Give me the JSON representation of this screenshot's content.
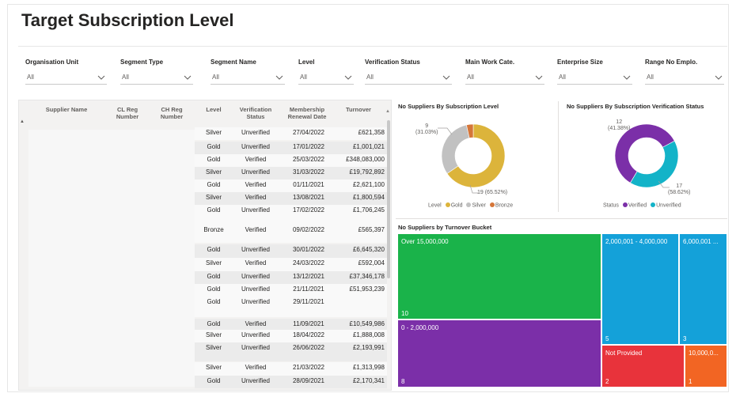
{
  "page": {
    "title": "Target Subscription Level"
  },
  "filters": [
    {
      "label": "Organisation Unit",
      "value": "All"
    },
    {
      "label": "Segment Type",
      "value": "All"
    },
    {
      "label": "Segment Name",
      "value": "All"
    },
    {
      "label": "Level",
      "value": "All"
    },
    {
      "label": "Verification Status",
      "value": "All"
    },
    {
      "label": "Main Work Cate.",
      "value": "All"
    },
    {
      "label": "Enterprise Size",
      "value": "All"
    },
    {
      "label": "Range No Emplo.",
      "value": "All"
    }
  ],
  "table": {
    "columns": [
      "Supplier Name",
      "CL Reg Number",
      "CH Reg Number",
      "Level",
      "Verification Status",
      "Membership Renewal Date",
      "Turnover"
    ],
    "rows": [
      {
        "level": "Silver",
        "status": "Unverified",
        "date": "27/04/2022",
        "turnover": "£621,358"
      },
      {
        "level": "Gold",
        "status": "Unverified",
        "date": "17/01/2022",
        "turnover": "£1,001,021"
      },
      {
        "level": "Gold",
        "status": "Verified",
        "date": "25/03/2022",
        "turnover": "£348,083,000"
      },
      {
        "level": "Silver",
        "status": "Unverified",
        "date": "31/03/2022",
        "turnover": "£19,792,892"
      },
      {
        "level": "Gold",
        "status": "Verified",
        "date": "01/11/2021",
        "turnover": "£2,621,100"
      },
      {
        "level": "Silver",
        "status": "Verified",
        "date": "13/08/2021",
        "turnover": "£1,800,594"
      },
      {
        "level": "Gold",
        "status": "Unverified",
        "date": "17/02/2022",
        "turnover": "£1,706,245"
      },
      {
        "level": "Bronze",
        "status": "Verified",
        "date": "09/02/2022",
        "turnover": "£565,397"
      },
      {
        "level": "Gold",
        "status": "Unverified",
        "date": "30/01/2022",
        "turnover": "£6,645,320"
      },
      {
        "level": "Silver",
        "status": "Verified",
        "date": "24/03/2022",
        "turnover": "£592,004"
      },
      {
        "level": "Gold",
        "status": "Unverified",
        "date": "13/12/2021",
        "turnover": "£37,346,178"
      },
      {
        "level": "Gold",
        "status": "Unverified",
        "date": "21/11/2021",
        "turnover": "£51,953,239"
      },
      {
        "level": "Gold",
        "status": "Unverified",
        "date": "29/11/2021",
        "turnover": ""
      },
      {
        "level": "Gold",
        "status": "Verified",
        "date": "11/09/2021",
        "turnover": "£10,549,986"
      },
      {
        "level": "Silver",
        "status": "Unverified",
        "date": "18/04/2022",
        "turnover": "£1,888,008"
      },
      {
        "level": "Silver",
        "status": "Unverified",
        "date": "26/06/2022",
        "turnover": "£2,193,991"
      },
      {
        "level": "Silver",
        "status": "Verified",
        "date": "21/03/2022",
        "turnover": "£1,313,998"
      },
      {
        "level": "Gold",
        "status": "Unverified",
        "date": "28/09/2021",
        "turnover": "£2,170,341"
      }
    ]
  },
  "chart_data": [
    {
      "type": "pie",
      "title": "No Suppliers By Subscription Level",
      "legend_title": "Level",
      "legend_position": "bottom",
      "categories": [
        "Gold",
        "Silver",
        "Bronze"
      ],
      "values": [
        19,
        9,
        1
      ],
      "colors": [
        "#dcb43b",
        "#c1c1c1",
        "#d57639"
      ],
      "labels": [
        "9\n(31.03%)",
        "19 (65.52%)"
      ]
    },
    {
      "type": "pie",
      "title": "No Suppliers By Subscription Verification Status",
      "legend_title": "Status",
      "legend_position": "bottom",
      "categories": [
        "Verified",
        "Unverified"
      ],
      "values": [
        17,
        12
      ],
      "colors": [
        "#7b2fa8",
        "#13b3c8"
      ],
      "labels": [
        "12\n(41.38%)",
        "17\n(58.62%)"
      ]
    },
    {
      "type": "treemap",
      "title": "No Suppliers by Turnover Bucket",
      "categories": [
        "Over 15,000,000",
        "0 - 2,000,000",
        "2,000,001 - 4,000,000",
        "6,000,001 ...",
        "Not Provided",
        "10,000,0..."
      ],
      "values": [
        10,
        8,
        5,
        3,
        2,
        1
      ],
      "colors": [
        "#1ab34a",
        "#7b2fa8",
        "#14a1d9",
        "#14a1d9",
        "#e8333b",
        "#f26523"
      ]
    }
  ]
}
